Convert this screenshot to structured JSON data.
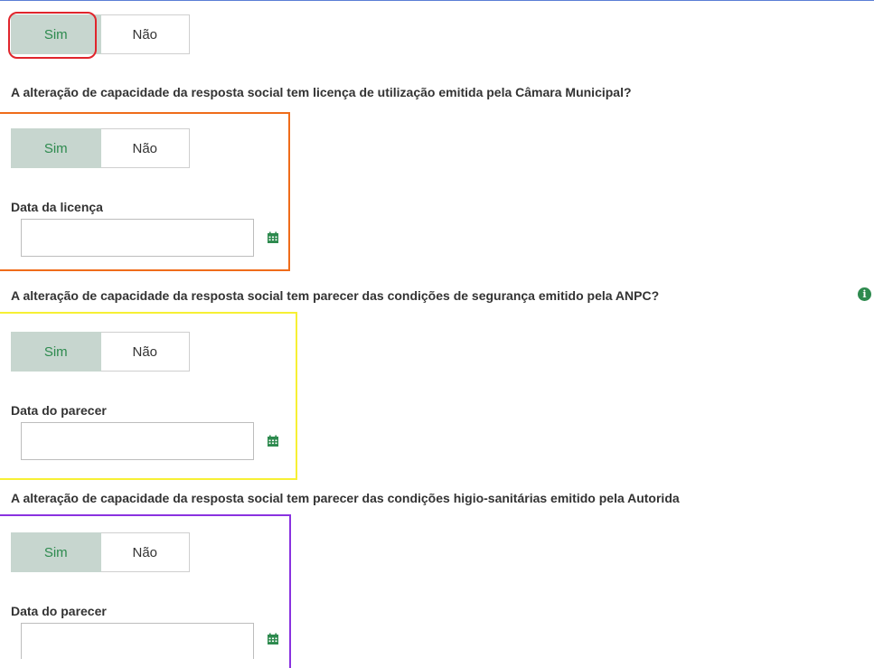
{
  "toggle_labels": {
    "sim": "Sim",
    "nao": "Não"
  },
  "questions": {
    "q1": "A alteração de capacidade da resposta social tem licença de utilização emitida pela Câmara Municipal?",
    "q2": "A alteração de capacidade da resposta social tem parecer das condições de segurança emitido pela ANPC?",
    "q3": "A alteração de capacidade da resposta social tem parecer das condições higio-sanitárias emitido pela Autorida"
  },
  "fields": {
    "licence_date_label": "Data da licença",
    "opinion_date_label_1": "Data do parecer",
    "opinion_date_label_2": "Data do parecer"
  },
  "icons": {
    "calendar": "calendar-icon",
    "info": "info-icon"
  },
  "colors": {
    "selected_bg": "#c7d6cf",
    "selected_text": "#2d8a4e",
    "accent_green": "#2d8a4e"
  }
}
